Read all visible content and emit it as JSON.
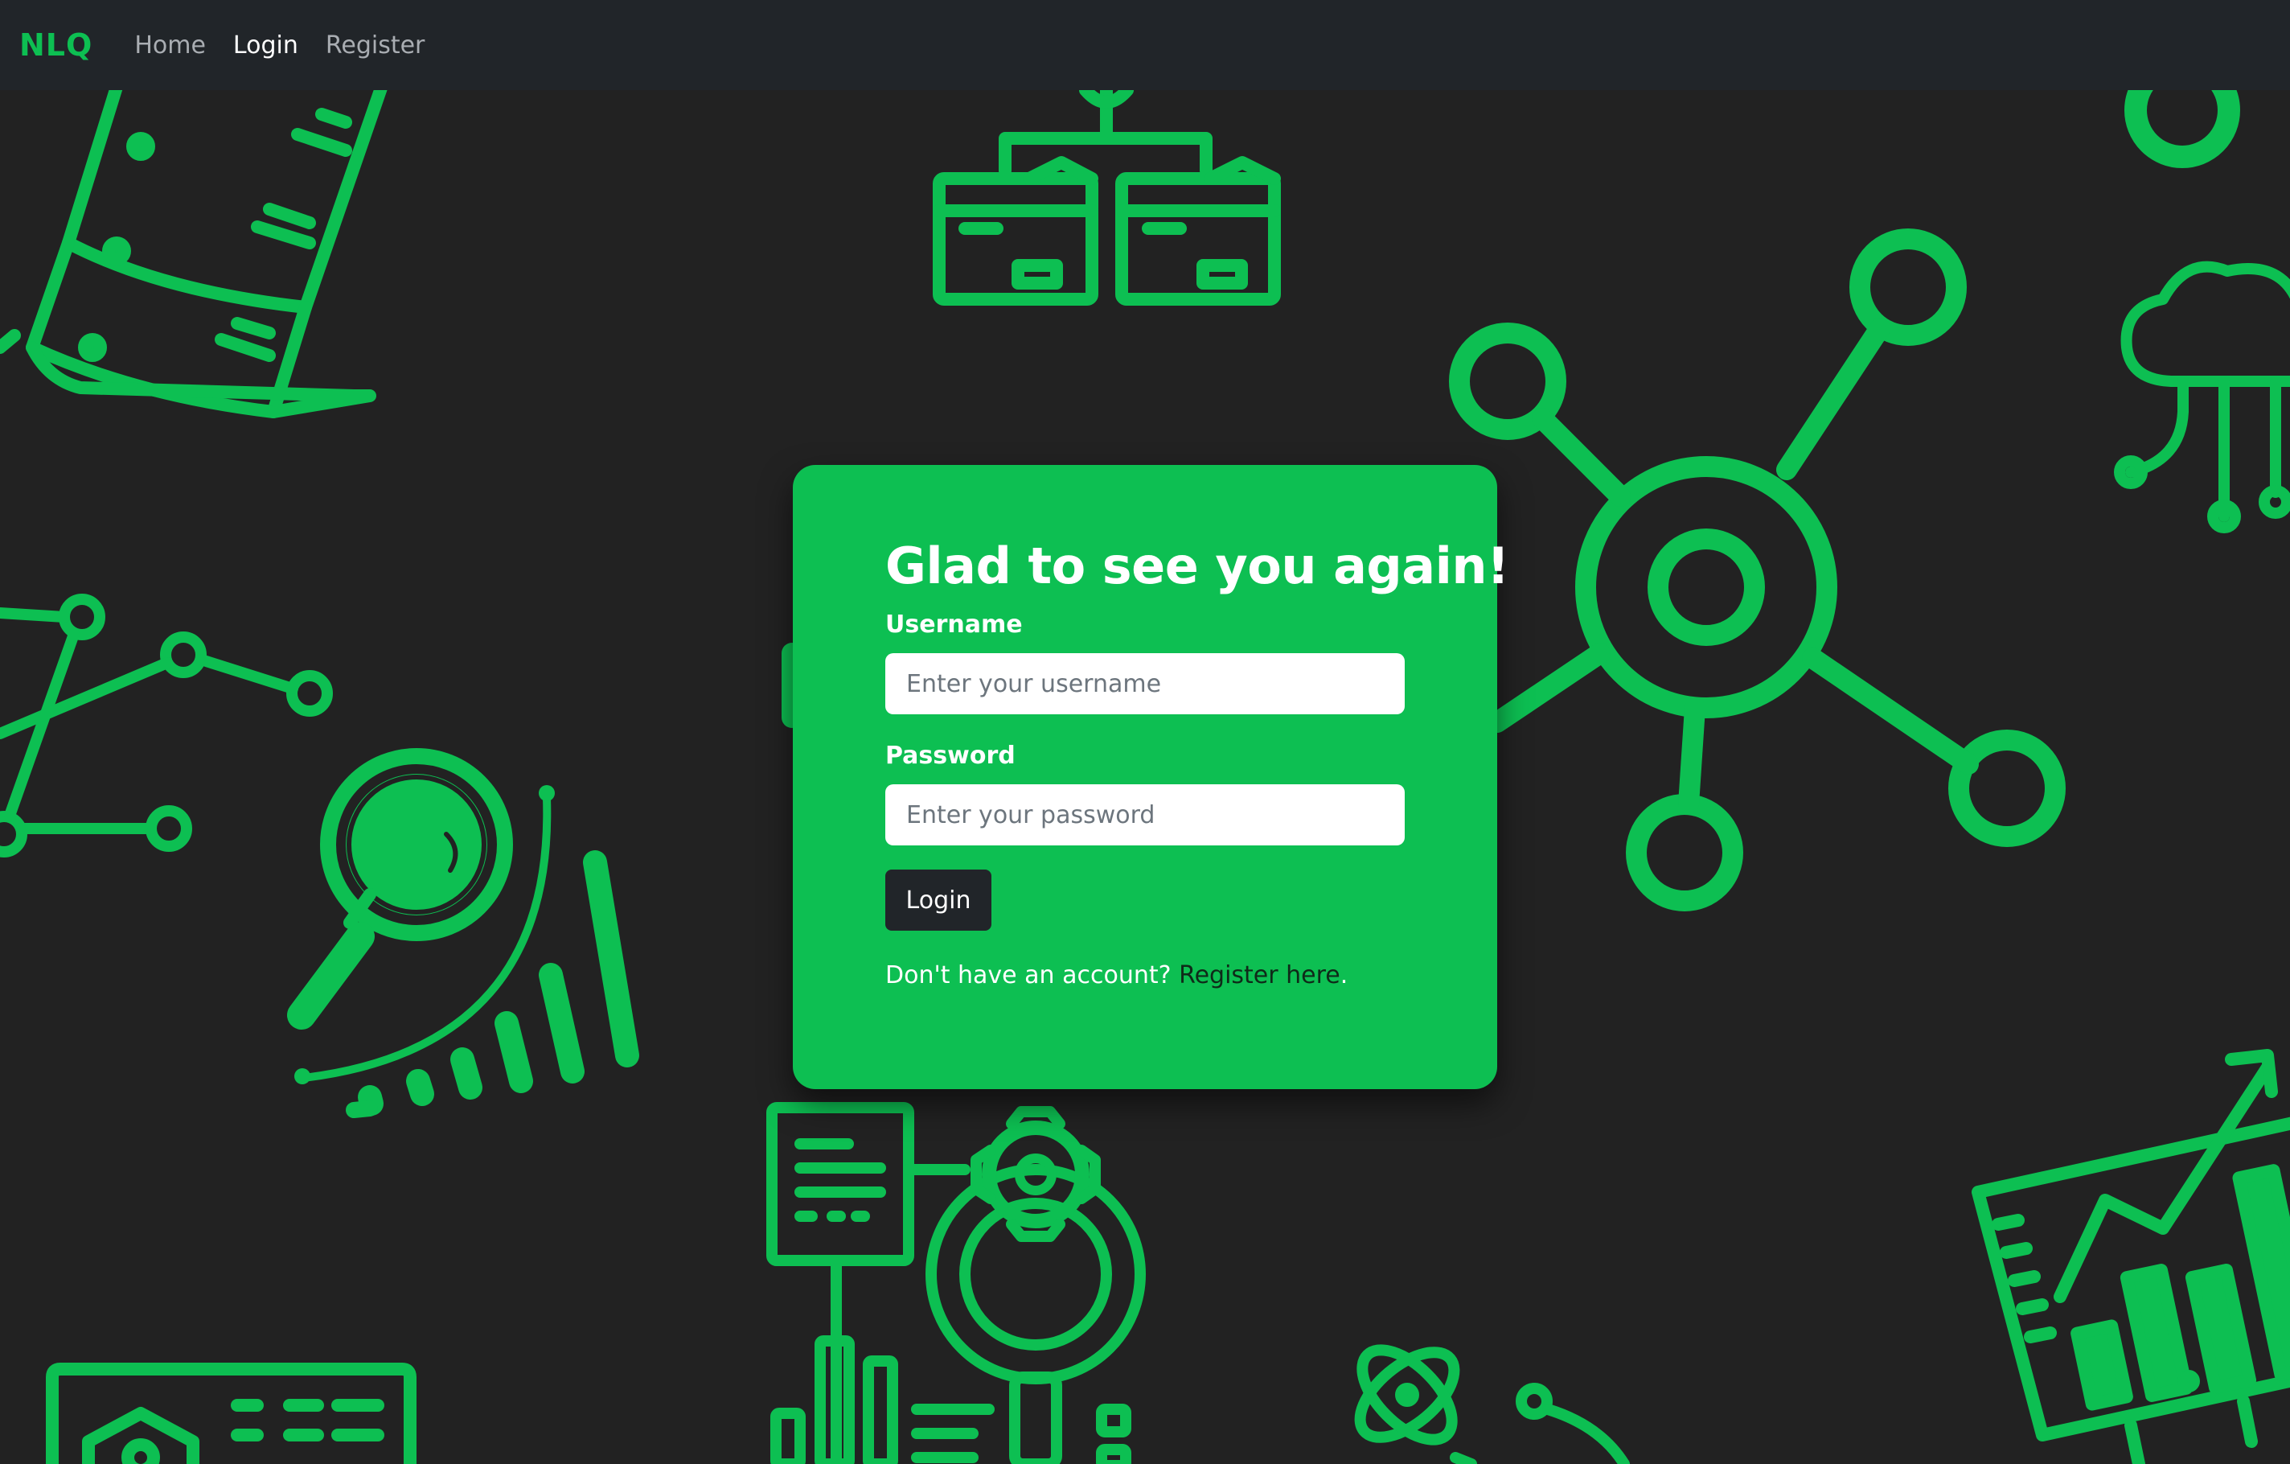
{
  "navbar": {
    "brand": "NLQ",
    "links": [
      {
        "label": "Home",
        "active": false
      },
      {
        "label": "Login",
        "active": true
      },
      {
        "label": "Register",
        "active": false
      }
    ]
  },
  "login_card": {
    "heading": "Glad to see you again!",
    "username": {
      "label": "Username",
      "placeholder": "Enter your username",
      "value": ""
    },
    "password": {
      "label": "Password",
      "placeholder": "Enter your password",
      "value": ""
    },
    "submit_label": "Login",
    "footer_prefix": "Don't have an account? ",
    "footer_link": "Register here",
    "footer_suffix": "."
  },
  "colors": {
    "accent": "#0dbf52",
    "navbar_bg": "#212529",
    "page_bg": "#222222",
    "button_bg": "#212529"
  },
  "background_icons": [
    "database-icon",
    "folders-network-icon",
    "ring-icon",
    "hub-network-icon",
    "cloud-circuit-icon",
    "node-graph-icon",
    "magnifier-analytics-icon",
    "document-gear-search-icon",
    "atom-icon",
    "monitor-chart-icon",
    "id-card-icon"
  ]
}
